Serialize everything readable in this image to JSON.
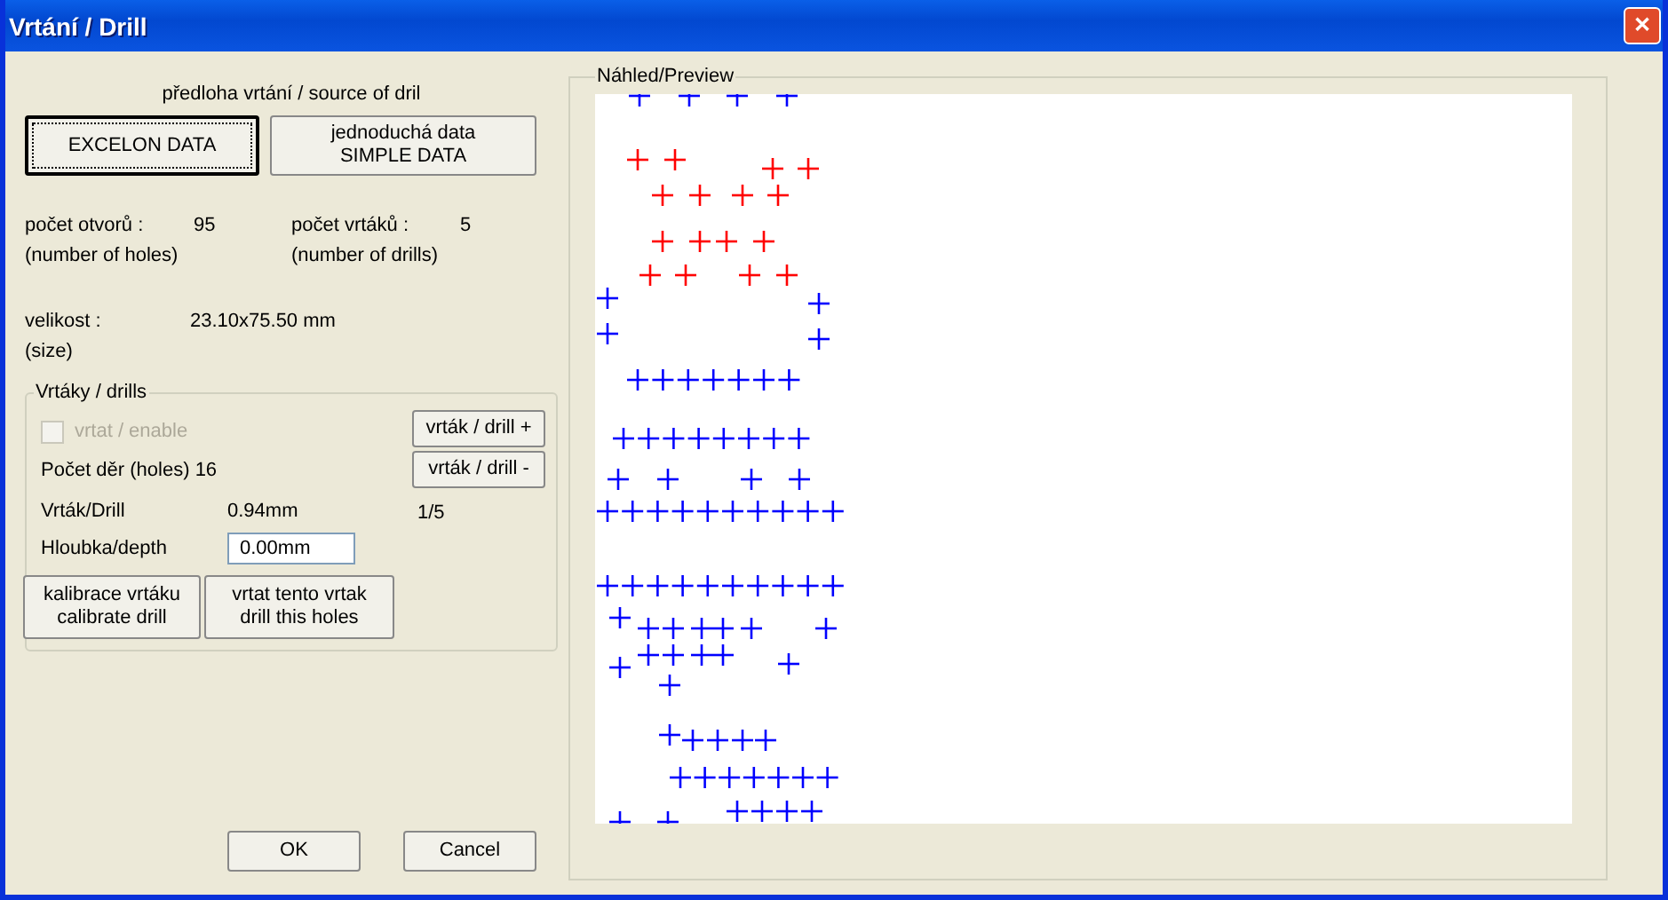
{
  "window": {
    "title": "Vrtání / Drill",
    "close": "✕"
  },
  "source": {
    "label": "předloha vrtání / source of dril",
    "buttons": [
      {
        "label": "EXCELON DATA",
        "default": true
      },
      {
        "label": "jednoduchá data\nSIMPLE DATA",
        "default": false
      }
    ]
  },
  "stats": [
    {
      "label": "počet otvorů :\n(number of holes)",
      "value": "95"
    },
    {
      "label": "počet vrtáků :\n(number of drills)",
      "value": "5"
    }
  ],
  "size": {
    "label": "velikost :\n(size)",
    "value": "23.10x75.50 mm"
  },
  "drills": {
    "title": "Vrtáky / drills",
    "enable": {
      "label": "vrtat / enable",
      "checked": false,
      "disabled": true
    },
    "holes": "Počet děr (holes) 16",
    "drill_label": "Vrták/Drill",
    "drill_value": "0.94mm",
    "depth_label": "Hloubka/depth",
    "depth_value": "0.00mm",
    "next_button": "vrták / drill +",
    "prev_button": "vrták / drill -",
    "position": "1/5",
    "actions": [
      "kalibrace vrtáku\ncalibrate drill",
      "vrtat tento vrtak\ndrill this holes"
    ]
  },
  "preview": {
    "title": "Náhled/Preview"
  },
  "buttons": [
    "OK",
    "Cancel"
  ]
}
